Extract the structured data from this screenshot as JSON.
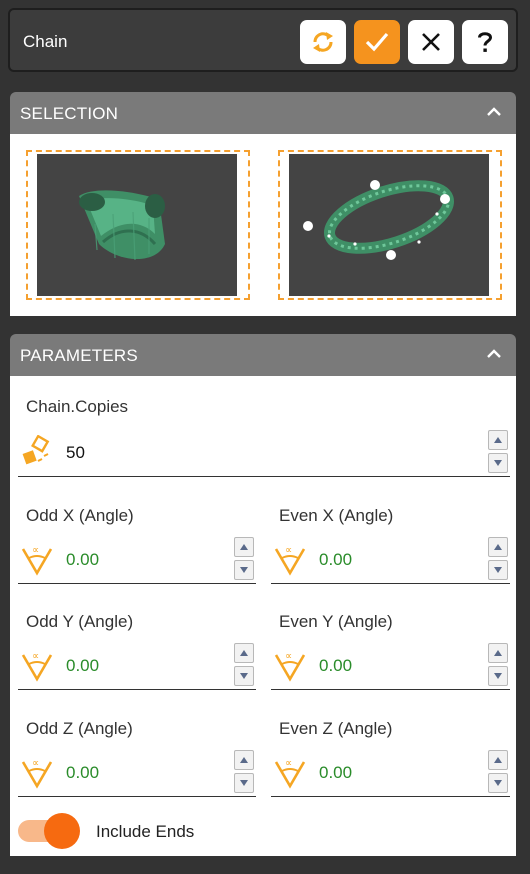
{
  "window": {
    "title": "Chain"
  },
  "toolbar": {
    "refresh_icon": "refresh-icon",
    "apply_icon": "check-icon",
    "close_icon": "close-icon",
    "help_icon": "help-icon",
    "accent": "#f5931e"
  },
  "selection": {
    "header": "SELECTION",
    "thumbnails": [
      {
        "name": "link-part-thumbnail"
      },
      {
        "name": "ring-path-thumbnail"
      }
    ]
  },
  "parameters": {
    "header": "PARAMETERS",
    "copies": {
      "label": "Chain.Copies",
      "value": "50"
    },
    "odd_x": {
      "label": "Odd X (Angle)",
      "value": "0.00"
    },
    "even_x": {
      "label": "Even X (Angle)",
      "value": "0.00"
    },
    "odd_y": {
      "label": "Odd Y (Angle)",
      "value": "0.00"
    },
    "even_y": {
      "label": "Even Y (Angle)",
      "value": "0.00"
    },
    "odd_z": {
      "label": "Odd Z (Angle)",
      "value": "0.00"
    },
    "even_z": {
      "label": "Even Z (Angle)",
      "value": "0.00"
    },
    "include_ends": {
      "label": "Include Ends",
      "on": true
    }
  }
}
